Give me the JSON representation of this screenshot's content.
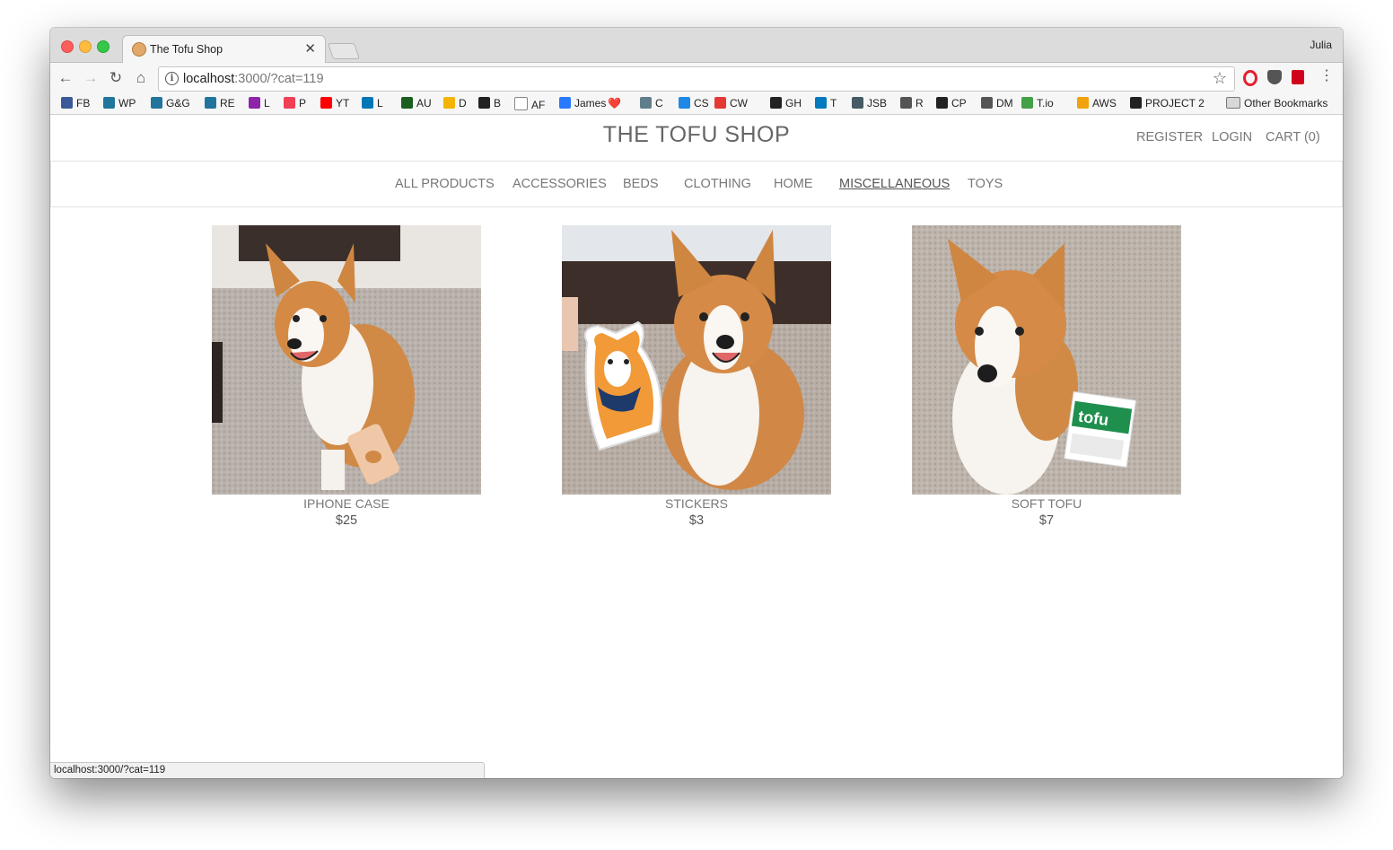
{
  "browser": {
    "tab_title": "The Tofu Shop",
    "profile_name": "Julia",
    "url_host": "localhost",
    "url_rest": ":3000/?cat=119",
    "status_url": "localhost:3000/?cat=119"
  },
  "bookmarks": [
    {
      "label": "FB",
      "icon": "facebook-icon",
      "color": "#3b5998"
    },
    {
      "label": "WP",
      "icon": "wordpress-icon",
      "color": "#21759b"
    },
    {
      "label": "G&G",
      "icon": "wordpress-icon",
      "color": "#21759b"
    },
    {
      "label": "RE",
      "icon": "wordpress-icon",
      "color": "#21759b"
    },
    {
      "label": "L",
      "icon": "l-icon",
      "color": "#8e24aa"
    },
    {
      "label": "P",
      "icon": "pocket-icon",
      "color": "#ef4056"
    },
    {
      "label": "YT",
      "icon": "youtube-icon",
      "color": "#ff0000"
    },
    {
      "label": "L",
      "icon": "linkedin-icon",
      "color": "#0077b5"
    },
    {
      "label": "AU",
      "icon": "au-icon",
      "color": "#1b5e20"
    },
    {
      "label": "D",
      "icon": "drive-icon",
      "color": "#f4b400"
    },
    {
      "label": "B",
      "icon": "b-icon",
      "color": "#222222"
    },
    {
      "label": "AF",
      "icon": "file-icon",
      "color": "#ffffff"
    },
    {
      "label": "James",
      "icon": "u-icon",
      "color": "#2979ff",
      "suffix": "❤️"
    },
    {
      "label": "C",
      "icon": "c-icon",
      "color": "#607d8b"
    },
    {
      "label": "CS",
      "icon": "code-icon",
      "color": "#1e88e5"
    },
    {
      "label": "CW",
      "icon": "codewars-icon",
      "color": "#e53935"
    },
    {
      "label": "GH",
      "icon": "github-icon",
      "color": "#222222"
    },
    {
      "label": "T",
      "icon": "trello-icon",
      "color": "#0079bf"
    },
    {
      "label": "JSB",
      "icon": "jsbin-icon",
      "color": "#455a64"
    },
    {
      "label": "R",
      "icon": "r-icon",
      "color": "#555555"
    },
    {
      "label": "CP",
      "icon": "codepen-icon",
      "color": "#222222"
    },
    {
      "label": "DM",
      "icon": "code-icon",
      "color": "#555555"
    },
    {
      "label": "T.io",
      "icon": "t-icon",
      "color": "#43a047"
    },
    {
      "label": "AWS",
      "icon": "aws-icon",
      "color": "#f0a30a"
    },
    {
      "label": "PROJECT 2",
      "icon": "github-icon",
      "color": "#222222"
    }
  ],
  "other_bookmarks": "Other Bookmarks",
  "site": {
    "brand": "THE TOFU SHOP",
    "register": "REGISTER",
    "login": "LOGIN",
    "cart": "CART (0)"
  },
  "categories": [
    {
      "label": "ALL PRODUCTS",
      "active": false
    },
    {
      "label": "ACCESSORIES",
      "active": false
    },
    {
      "label": "BEDS",
      "active": false
    },
    {
      "label": "CLOTHING",
      "active": false
    },
    {
      "label": "HOME",
      "active": false
    },
    {
      "label": "MISCELLANEOUS",
      "active": true
    },
    {
      "label": "TOYS",
      "active": false
    }
  ],
  "products": [
    {
      "name": "IPHONE CASE",
      "price": "$25"
    },
    {
      "name": "STICKERS",
      "price": "$3"
    },
    {
      "name": "SOFT TOFU",
      "price": "$7"
    }
  ]
}
